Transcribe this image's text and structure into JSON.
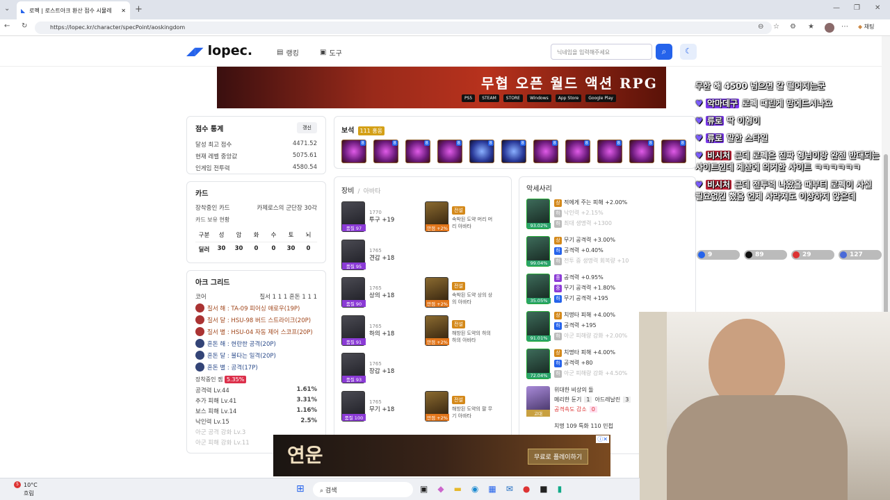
{
  "browser": {
    "tab_title": "로펙 | 로스트아크 환산 점수 시뮬레",
    "url": "https://lopec.kr/character/specPoint/aoskingdom",
    "profile_label": "채팅"
  },
  "site": {
    "logo": "lopec.",
    "nav": [
      "랭킹",
      "도구"
    ],
    "search_placeholder": "닉네임을 입력해주세요"
  },
  "banner": {
    "title": "무협 오픈 월드 액션 RPG",
    "platforms": [
      "PS5",
      "STEAM",
      "STORE",
      "Windows",
      "App Store",
      "Google Play"
    ]
  },
  "score": {
    "title": "점수 통계",
    "update": "갱신",
    "rows": [
      {
        "label": "달성 최고 점수",
        "value": "4471.52"
      },
      {
        "label": "현재 레벨 중앙값",
        "value": "5075.61"
      },
      {
        "label": "인게임 전투력",
        "value": "4580.54"
      }
    ]
  },
  "gems": {
    "title": "보석",
    "badge": "111 홍옹",
    "items": [
      "8",
      "8",
      "8",
      "8",
      "8",
      "8",
      "8",
      "8",
      "8",
      "8",
      "8"
    ]
  },
  "card": {
    "title": "카드",
    "equipped_label": "장착중인 카드",
    "equipped_value": "카제로스의 군단장 30각",
    "owned_label": "카드 보유 현황",
    "headers": [
      "구분",
      "성",
      "암",
      "화",
      "수",
      "토",
      "뇌"
    ],
    "row": [
      "딜러",
      "30",
      "30",
      "0",
      "0",
      "30",
      "0"
    ]
  },
  "equip": {
    "title": "장비",
    "subtitle": "아바타",
    "items": [
      {
        "q": "품질 97",
        "lv": "1770",
        "name": "투구 +19",
        "quality_pct": 97
      },
      {
        "q": "품질 95",
        "lv": "1765",
        "name": "견갑 +18",
        "quality_pct": 95
      },
      {
        "q": "품질 90",
        "lv": "1765",
        "name": "상의 +18",
        "quality_pct": 90
      },
      {
        "q": "품질 91",
        "lv": "1765",
        "name": "하의 +18",
        "quality_pct": 91
      },
      {
        "q": "품질 93",
        "lv": "1765",
        "name": "장갑 +18",
        "quality_pct": 93
      },
      {
        "q": "품질 100",
        "lv": "1765",
        "name": "무기 +18",
        "quality_pct": 100
      }
    ],
    "avatars": [
      {
        "tag": "전설",
        "name": "속박된 도약 머리 머리 아바타",
        "q": "만점 +2%",
        "row": 0
      },
      {
        "tag": "전설",
        "name": "속박된 도약 상의 상의 아바타",
        "q": "만점 +2%",
        "row": 2
      },
      {
        "tag": "전설",
        "name": "해방된 도약의 하의 하의 아바타",
        "q": "만점 +2%",
        "row": 3
      },
      {
        "tag": "전설",
        "name": "해방된 도약의 팔 무기 아바타",
        "q": "만점 +2%",
        "row": 5
      }
    ]
  },
  "acc": {
    "title": "악세사리",
    "items": [
      {
        "pct": "93.02%",
        "lines": [
          {
            "l": "상",
            "t": "적에게 주는 피해 +2.00%",
            "c": "#d4891a"
          },
          {
            "l": "하",
            "t": "낙인력 +2.15%",
            "c": "#bbb"
          },
          {
            "l": "하",
            "t": "최대 생명력 +1300",
            "c": "#bbb"
          }
        ]
      },
      {
        "pct": "99.04%",
        "lines": [
          {
            "l": "상",
            "t": "무기 공격력 +3.00%",
            "c": "#d4891a"
          },
          {
            "l": "하",
            "t": "공격력 +0.40%",
            "c": "#2563eb"
          },
          {
            "l": "하",
            "t": "전투 중 생명력 회복량 +10",
            "c": "#bbb"
          }
        ]
      },
      {
        "pct": "35.05%",
        "lines": [
          {
            "l": "중",
            "t": "공격력 +0.95%",
            "c": "#8b3bd6"
          },
          {
            "l": "중",
            "t": "무기 공격력 +1.80%",
            "c": "#8b3bd6"
          },
          {
            "l": "하",
            "t": "무기 공격력 +195",
            "c": "#2563eb"
          }
        ]
      },
      {
        "pct": "91.01%",
        "lines": [
          {
            "l": "상",
            "t": "치명타 피해 +4.00%",
            "c": "#d4891a"
          },
          {
            "l": "하",
            "t": "공격력 +195",
            "c": "#2563eb"
          },
          {
            "l": "하",
            "t": "아군 피해량 강화 +2.00%",
            "c": "#bbb"
          }
        ]
      },
      {
        "pct": "72.04%",
        "lines": [
          {
            "l": "상",
            "t": "치명타 피해 +4.00%",
            "c": "#d4891a"
          },
          {
            "l": "하",
            "t": "공격력 +80",
            "c": "#2563eb"
          },
          {
            "l": "하",
            "t": "아군 피해량 강화 +4.50%",
            "c": "#bbb"
          }
        ]
      }
    ],
    "bracelet": {
      "q": "고대",
      "name": "위대한 비상의 돌",
      "line2": "메리한 둔기",
      "n1": "1",
      "line2b": "아드레날린",
      "n2": "3",
      "line3": "공격속도 감소",
      "n3": "0"
    },
    "last": "치명 109  특화 110  민첩"
  },
  "ark": {
    "title": "아크 그리드",
    "core_label": "코어",
    "core_value": "질서 1 1 1 혼돈 1 1 1",
    "cores": [
      "질서 해 : TA-09 피어싱 애로우(19P)",
      "질서 달 : HSU-98 버드 스트라이크(20P)",
      "질서 별 : HSU-04 자동 제어 스코프(20P)",
      "혼돈 해 : 현란한 공격(20P)",
      "혼돈 달 : 불타는 일격(20P)",
      "혼돈 별 : 공격(17P)"
    ],
    "gem_label": "장착중인 젬",
    "gem_value": "5.35%",
    "stats": [
      {
        "l": "공격력 Lv.44",
        "v": "1.61%"
      },
      {
        "l": "추가 피해 Lv.41",
        "v": "3.31%"
      },
      {
        "l": "보스 피해 Lv.14",
        "v": "1.16%"
      },
      {
        "l": "낙인력 Lv.15",
        "v": "2.5%"
      },
      {
        "l": "아군 공격 강화 Lv.3",
        "v": ""
      },
      {
        "l": "아군 피해 강화 Lv.11",
        "v": ""
      }
    ]
  },
  "chat": [
    {
      "name": "",
      "text": "무한 해 4500 넘으면 갈 떨어지는군"
    },
    {
      "name": "악마데구",
      "text": "로펙 때린게 맘에드시나요"
    },
    {
      "name": "류로",
      "text": "딱 이형이"
    },
    {
      "name": "류로",
      "text": "말한 스타일"
    },
    {
      "name": "비시처",
      "text": "근데 로펙은 진짜 형님이랑 완전 반대되는 사이트인데 계산에 의거한 사이트 ㅋㅋㅋㅋㅋㅋ"
    },
    {
      "name": "비시처",
      "text": "근데 전투력 나왔을 때부터 로펙이 사실 필요없긴 했음 언제 사라져도 이상하지 않은데"
    }
  ],
  "viewers": [
    "9",
    "89",
    "29",
    "127"
  ],
  "ad": {
    "title": "연운",
    "cta": "무료로 플레이하기"
  },
  "taskbar": {
    "temp": "10°C",
    "weather": "흐림",
    "search": "검색",
    "badge": "5"
  }
}
